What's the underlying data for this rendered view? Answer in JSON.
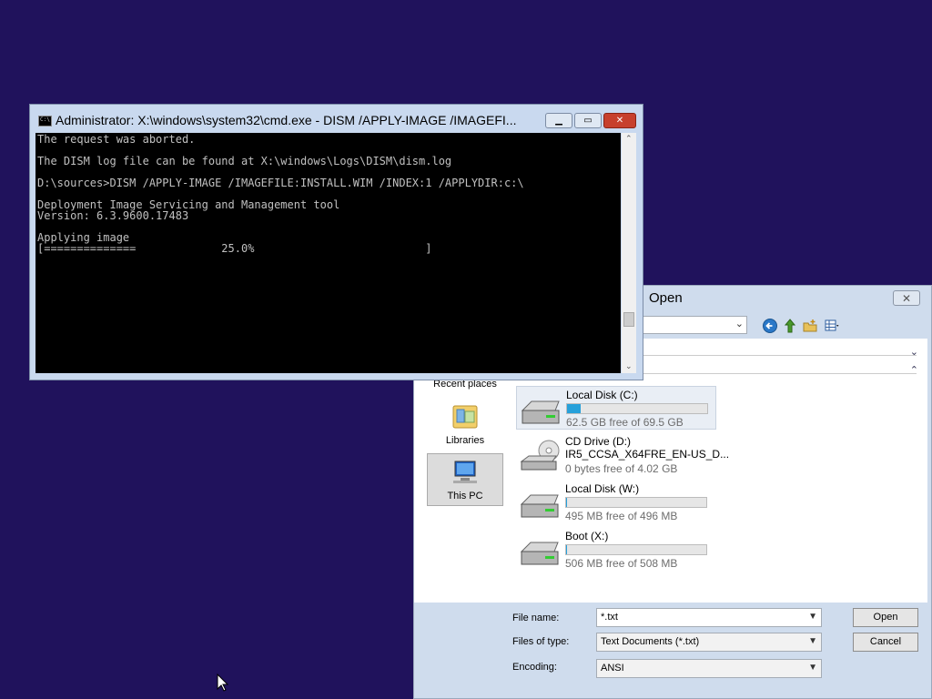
{
  "cmd": {
    "title": "Administrator: X:\\windows\\system32\\cmd.exe - DISM  /APPLY-IMAGE /IMAGEFI...",
    "lines": [
      "The request was aborted.",
      "",
      "The DISM log file can be found at X:\\windows\\Logs\\DISM\\dism.log",
      "",
      "D:\\sources>DISM /APPLY-IMAGE /IMAGEFILE:INSTALL.WIM /INDEX:1 /APPLYDIR:c:\\",
      "",
      "Deployment Image Servicing and Management tool",
      "Version: 6.3.9600.17483",
      "",
      "Applying image",
      "[==============             25.0%                          ]"
    ],
    "progress_percent": 25.0
  },
  "open_dialog": {
    "title": "Open",
    "nav": {
      "recent_places": "Recent places",
      "libraries": "Libraries",
      "this_pc": "This PC"
    },
    "drives": [
      {
        "name": "Local Disk (C:)",
        "free": "62.5 GB free of 69.5 GB",
        "used_fraction": 0.1
      },
      {
        "name": "CD Drive (D:)",
        "label": "IR5_CCSA_X64FRE_EN-US_D...",
        "free": "0 bytes free of 4.02 GB"
      },
      {
        "name": "Local Disk (W:)",
        "free": "495 MB free of 496 MB",
        "used_fraction": 0.002
      },
      {
        "name": "Boot (X:)",
        "free": "506 MB free of 508 MB",
        "used_fraction": 0.004
      }
    ],
    "file_name_label": "File name:",
    "file_name_value": "*.txt",
    "files_of_type_label": "Files of type:",
    "files_of_type_value": "Text Documents (*.txt)",
    "encoding_label": "Encoding:",
    "encoding_value": "ANSI",
    "open_button": "Open",
    "cancel_button": "Cancel"
  },
  "colors": {
    "desktop": "#20125c",
    "drive_bar_fill": "#26a0da",
    "close_button": "#c7402d"
  }
}
